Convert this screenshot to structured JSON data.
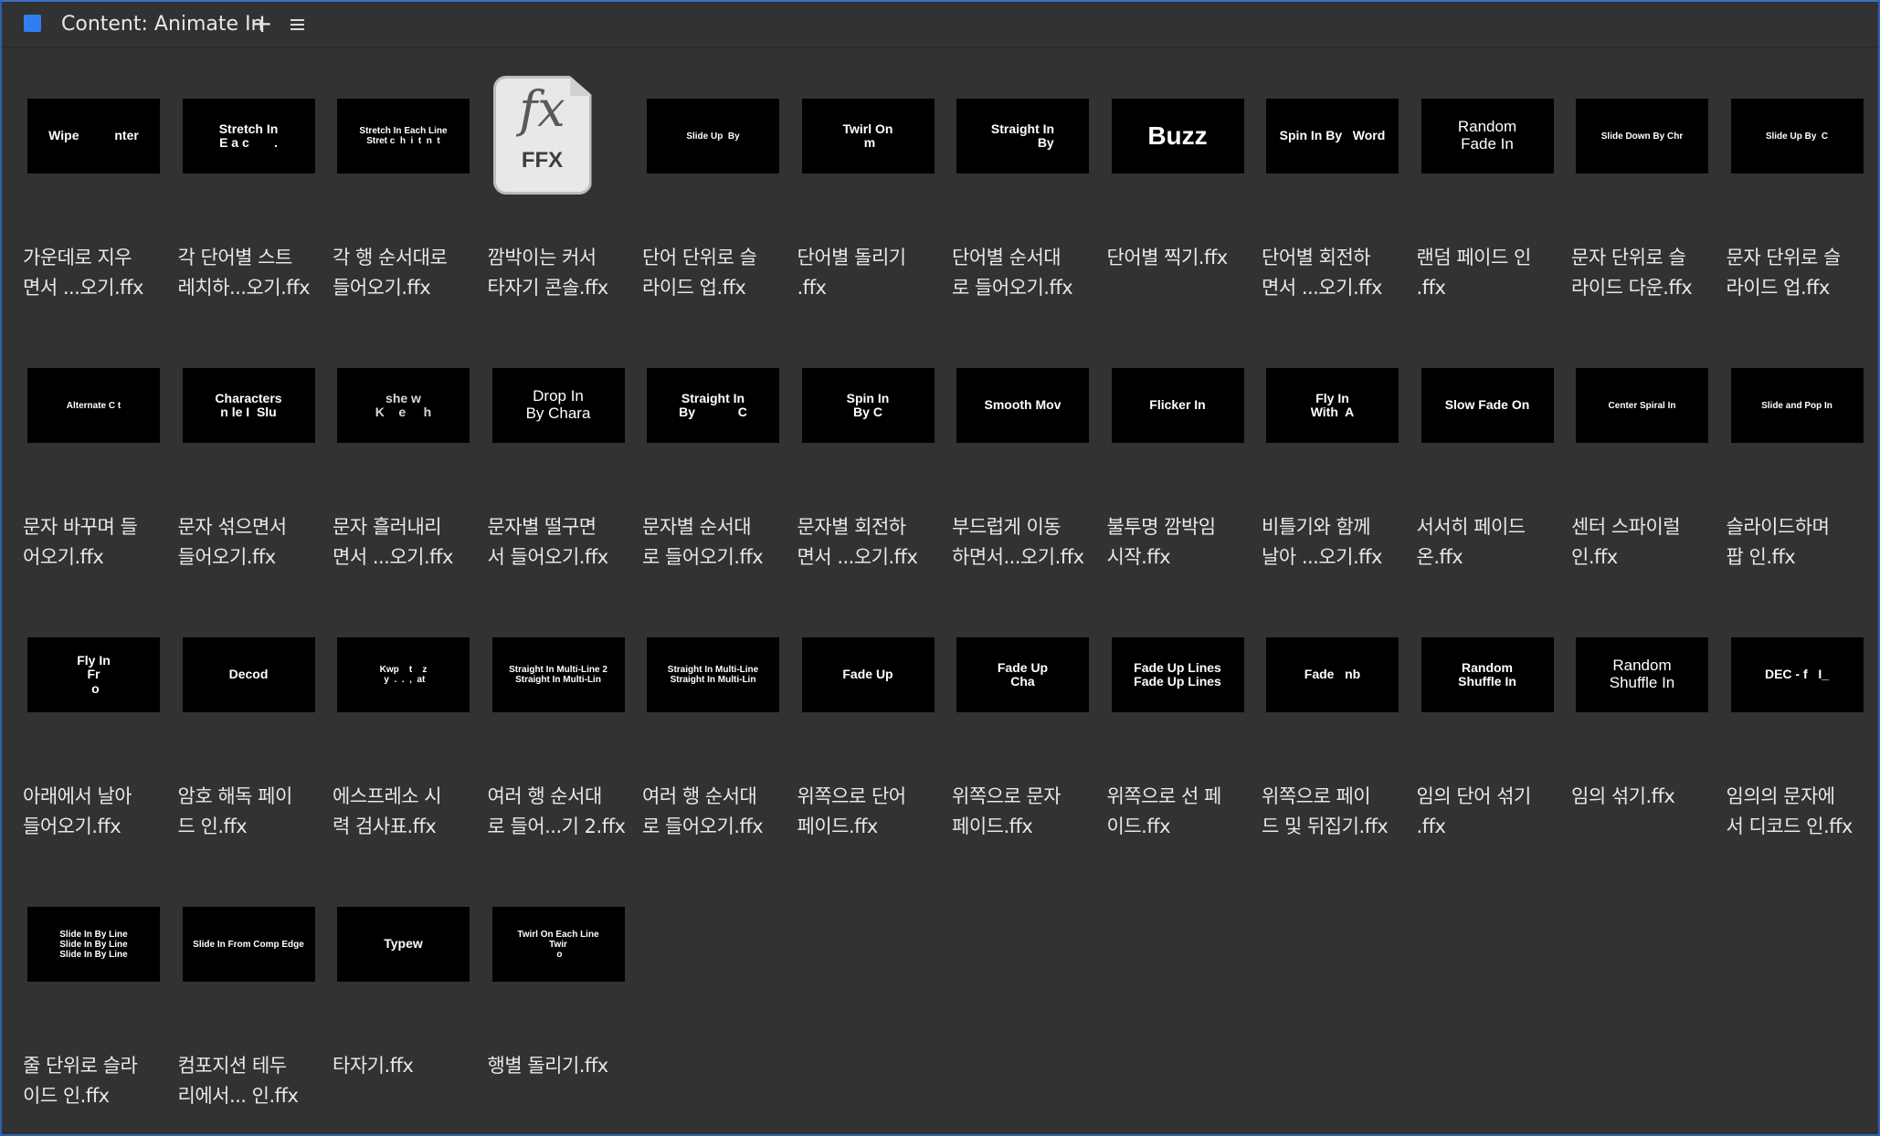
{
  "panel": {
    "title": "Content: Animate In",
    "color": "#2f7ff0",
    "add_label": "+",
    "menu_icon": "hamburger-menu-icon"
  },
  "items": [
    {
      "name": "가운데로 지우\n면서 ...오기.ffx",
      "thumb": "Wipe          nter",
      "style": ""
    },
    {
      "name": "각 단어별 스트\n레치하...오기.ffx",
      "thumb": "Stretch In\nE a c       .",
      "style": ""
    },
    {
      "name": "각 행 순서대로\n들어오기.ffx",
      "thumb": "Stretch In Each Line\nStret c  h  i  t  n  t",
      "style": "small"
    },
    {
      "name": "깜박이는 커서\n타자기 콘솔.ffx",
      "thumb": "FFX",
      "style": "ffx"
    },
    {
      "name": "단어 단위로 슬\n라이드 업.ffx",
      "thumb": "Slide Up  By",
      "style": "small"
    },
    {
      "name": "단어별 돌리기\n.ffx",
      "thumb": "Twirl On\n m",
      "style": ""
    },
    {
      "name": "단어별 순서대\n로 들어오기.ffx",
      "thumb": "Straight In\n             By",
      "style": ""
    },
    {
      "name": "단어별 찍기.ffx",
      "thumb": "Buzz",
      "style": "big"
    },
    {
      "name": "단어별 회전하\n면서 ...오기.ffx",
      "thumb": "Spin In By   Word",
      "style": ""
    },
    {
      "name": "랜덤 페이드 인\n.ffx",
      "thumb": "Random\nFade In",
      "style": "med"
    },
    {
      "name": "문자 단위로 슬\n라이드 다운.ffx",
      "thumb": "Slide Down By Chr",
      "style": "small"
    },
    {
      "name": "문자 단위로 슬\n라이드 업.ffx",
      "thumb": "Slide Up By  C",
      "style": "small"
    },
    {
      "name": "문자 바꾸며 들\n어오기.ffx",
      "thumb": "Alternate C t",
      "style": "small"
    },
    {
      "name": "문자 섞으면서\n들어오기.ffx",
      "thumb": "Characters\nn le I  Slu",
      "style": ""
    },
    {
      "name": "문자 흘러내리\n면서 ...오기.ffx",
      "thumb": "she w\nK    e     h",
      "style": "dim"
    },
    {
      "name": "문자별 떨구면\n서 들어오기.ffx",
      "thumb": "Drop In\nBy Chara",
      "style": "med"
    },
    {
      "name": "문자별 순서대\n로 들어오기.ffx",
      "thumb": "Straight In\nBy            C",
      "style": ""
    },
    {
      "name": "문자별 회전하\n면서 ...오기.ffx",
      "thumb": "Spin In\nBy C",
      "style": ""
    },
    {
      "name": "부드럽게 이동\n하면서...오기.ffx",
      "thumb": "Smooth Mov",
      "style": ""
    },
    {
      "name": "불투명 깜박임\n시작.ffx",
      "thumb": "Flicker In",
      "style": ""
    },
    {
      "name": "비틀기와 함께\n날아 ...오기.ffx",
      "thumb": "Fly In\nWith  A",
      "style": ""
    },
    {
      "name": "서서히 페이드\n온.ffx",
      "thumb": "Slow Fade On",
      "style": ""
    },
    {
      "name": "센터 스파이럴\n인.ffx",
      "thumb": "Center Spiral In",
      "style": "small"
    },
    {
      "name": "슬라이드하며\n팝 인.ffx",
      "thumb": "Slide and Pop In",
      "style": "small"
    },
    {
      "name": "아래에서 날아\n들어오기.ffx",
      "thumb": "Fly In\nFr\n o",
      "style": ""
    },
    {
      "name": "암호 해독 페이\n드 인.ffx",
      "thumb": "Decod",
      "style": ""
    },
    {
      "name": "에스프레소 시\n력 검사표.ffx",
      "thumb": "Kwp    t    z\n y  .  .  ,  at",
      "style": "small"
    },
    {
      "name": "여러 행 순서대\n로 들어...기 2.ffx",
      "thumb": "Straight In Multi-Line 2\nStraight In Multi-Lin",
      "style": "small"
    },
    {
      "name": "여러 행 순서대\n로 들어오기.ffx",
      "thumb": "Straight In Multi-Line\nStraight In Multi-Lin",
      "style": "small"
    },
    {
      "name": "위쪽으로 단어\n페이드.ffx",
      "thumb": "Fade Up",
      "style": ""
    },
    {
      "name": "위쪽으로 문자\n페이드.ffx",
      "thumb": "Fade Up\nCha",
      "style": ""
    },
    {
      "name": "위쪽으로 선 페\n이드.ffx",
      "thumb": "Fade Up Lines\nFade Up Lines",
      "style": ""
    },
    {
      "name": "위쪽으로 페이\n드 및 뒤집기.ffx",
      "thumb": "Fade   nb",
      "style": ""
    },
    {
      "name": "임의 단어 섞기\n.ffx",
      "thumb": "Random\nShuffle In",
      "style": ""
    },
    {
      "name": "임의 섞기.ffx",
      "thumb": "Random\nShuffle In",
      "style": "med"
    },
    {
      "name": "임의의 문자에\n서 디코드 인.ffx",
      "thumb": "DEC - f   I_",
      "style": ""
    },
    {
      "name": "줄 단위로 슬라\n이드 인.ffx",
      "thumb": "Slide In By Line\nSlide In By Line\nSlide In By Line",
      "style": "small"
    },
    {
      "name": "컴포지션 테두\n리에서... 인.ffx",
      "thumb": "Slide In From Comp Edge",
      "style": "small"
    },
    {
      "name": "타자기.ffx",
      "thumb": "Typew",
      "style": ""
    },
    {
      "name": "행별 돌리기.ffx",
      "thumb": "Twirl On Each Line\nTwir\n o",
      "style": "small"
    }
  ]
}
